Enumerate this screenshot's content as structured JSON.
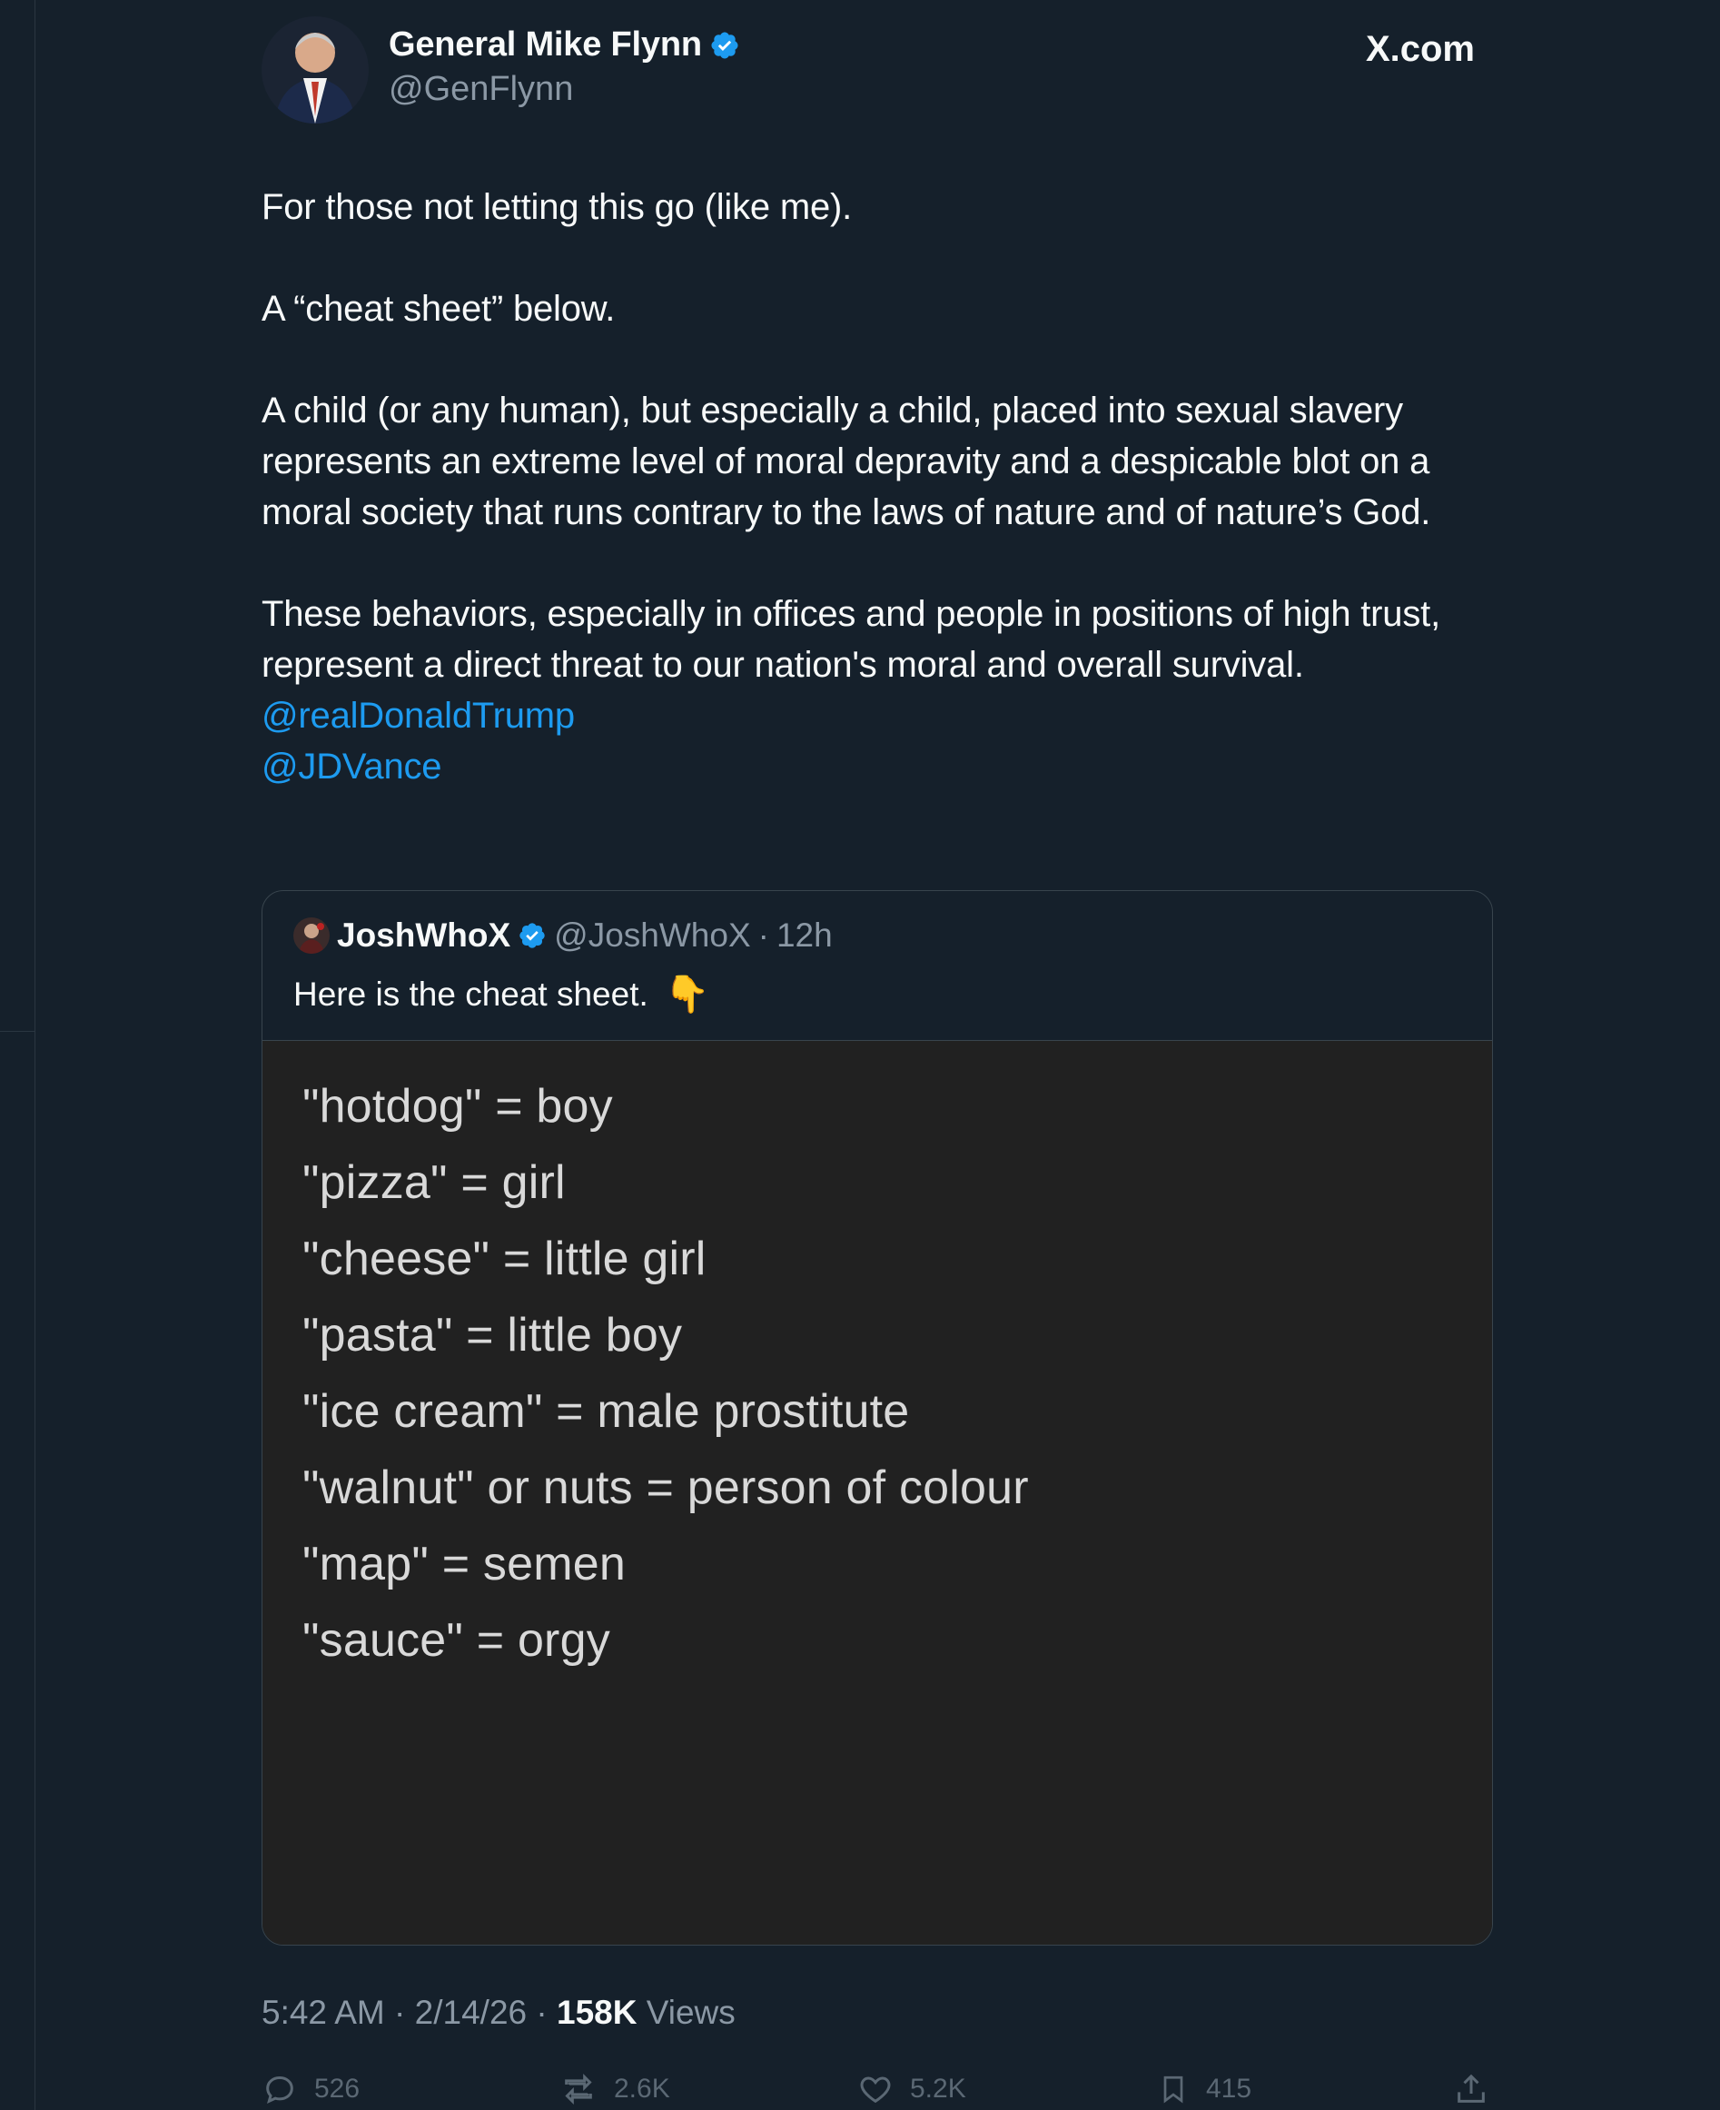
{
  "author": {
    "display_name": "General Mike Flynn",
    "handle": "@GenFlynn",
    "verified": true
  },
  "site_logo": "X.com",
  "post": {
    "paragraphs": [
      "For those not letting this go (like me).",
      "A “cheat sheet” below.",
      "A child (or any human), but especially a child, placed into sexual slavery represents an extreme level of moral depravity and a despicable blot on a moral society that runs contrary to the laws of nature and of nature’s God.",
      "These behaviors, especially in offices and people in positions of high trust, represent a direct threat to our nation's moral and overall survival."
    ],
    "mentions": [
      "@realDonaldTrump",
      "@JDVance"
    ]
  },
  "quote": {
    "display_name": "JoshWhoX",
    "handle": "@JoshWhoX",
    "separator": "·",
    "time": "12h",
    "text": "Here is the cheat sheet.",
    "emoji": "👇",
    "cheat_sheet": [
      "\"hotdog\" = boy",
      "\"pizza\" = girl",
      "\"cheese\" = little girl",
      "\"pasta\" = little boy",
      "\"ice cream\" = male prostitute",
      "\"walnut\" or nuts = person of colour",
      "\"map\" = semen",
      "\"sauce\" = orgy"
    ]
  },
  "footer": {
    "time": "5:42 AM",
    "date": "2/14/26",
    "separator": "·",
    "views_count": "158K",
    "views_label": "Views"
  },
  "actions": {
    "replies": "526",
    "reposts": "2.6K",
    "likes": "5.2K",
    "bookmarks": "415"
  },
  "colors": {
    "background": "#15202b",
    "accent": "#1d9bf0",
    "secondary_text": "#8b98a5",
    "cheat_sheet_bg": "#212121"
  }
}
